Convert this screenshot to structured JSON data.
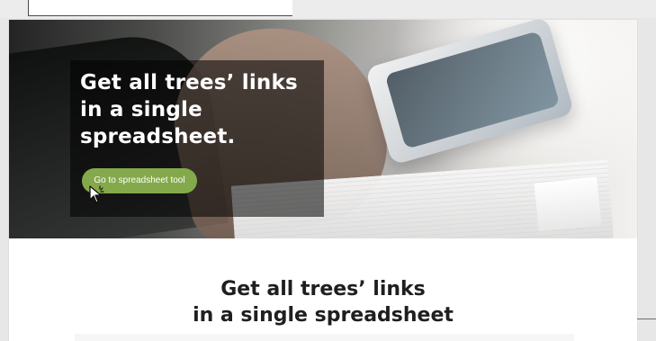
{
  "hero": {
    "title_line_1": "Get all trees’ links",
    "title_line_2": "in a single",
    "title_line_3": "spreadsheet.",
    "button_label": "Go to spreadsheet tool"
  },
  "content": {
    "title_line_1": "Get all trees’ links",
    "title_line_2": "in a single spreadsheet"
  },
  "colors": {
    "button_green": "#84a94b",
    "text_dark": "#1f1f1f",
    "white": "#ffffff"
  },
  "icons": {
    "cursor": "cursor-icon"
  }
}
